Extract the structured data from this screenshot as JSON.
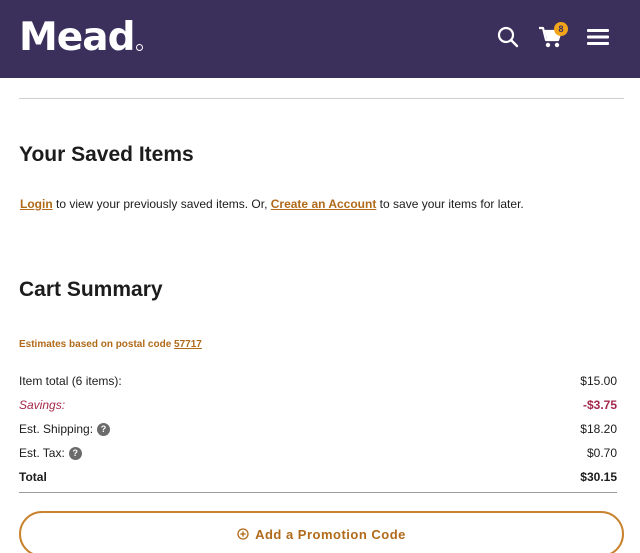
{
  "header": {
    "logo": "Mead",
    "cart_count": "8",
    "icons": {
      "search": "search-icon",
      "cart": "cart-icon",
      "menu": "hamburger-menu-icon"
    },
    "background_color": "#3b2f5c"
  },
  "saved_items": {
    "title": "Your Saved Items",
    "login_link": "Login",
    "text_middle": " to view your previously saved items. Or, ",
    "create_account_link": "Create an Account",
    "text_end": " to save your items for later."
  },
  "cart_summary": {
    "title": "Cart Summary",
    "estimate_text": "Estimates based on postal code ",
    "postal_code": "57717",
    "rows": [
      {
        "label": "Item total (6 items):",
        "value": "$15.00"
      },
      {
        "label": "Savings:",
        "value": "-$3.75"
      },
      {
        "label": "Est. Shipping:",
        "value": "$18.20"
      },
      {
        "label": "Est. Tax:",
        "value": "$0.70"
      },
      {
        "label": "Total",
        "value": "$30.15"
      }
    ],
    "help_icon_glyph": "?",
    "promo_button": "Add a Promotion Code"
  },
  "colors": {
    "accent": "#b06a1a",
    "savings": "#a3294a",
    "badge": "#f2a41b"
  }
}
